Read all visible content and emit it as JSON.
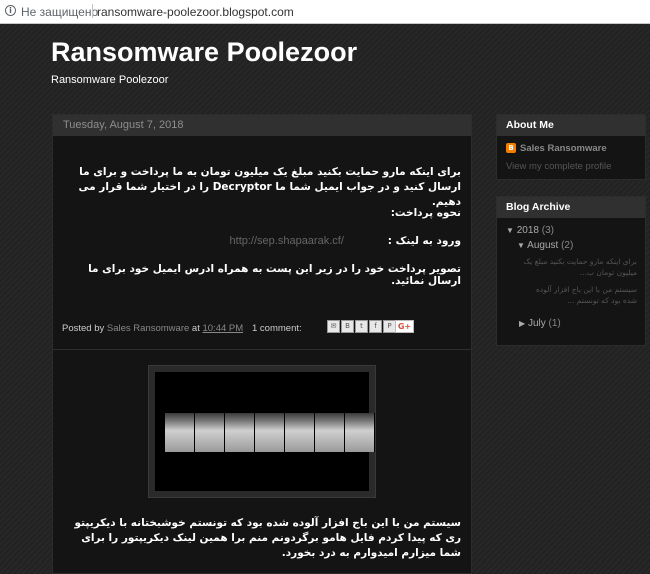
{
  "browser": {
    "security_label": "Не защищено",
    "url": "ransomware-poolezoor.blogspot.com"
  },
  "header": {
    "title": "Ransomware Poolezoor",
    "description": "Ransomware Poolezoor"
  },
  "post": {
    "date": "Tuesday, August 7, 2018",
    "paragraph1": "برای اینکه مارو حمایت بکنید مبلغ یک میلیون تومان به ما پرداخت و برای ما ارسال کنید و در جواب ایمیل شما ما  Decryptor را در اختیار شما قرار می دهیم.",
    "paragraph2": "نحوه پرداخت:",
    "paragraph3_label": "ورود به لینک :",
    "paragraph3_link": "http://sep.shapaarak.cf/",
    "paragraph4": "تصویر پرداخت خود را در زیر این پست به همراه ادرس ایمیل خود برای ما ارسال نمائید.",
    "footer": {
      "posted_by": "Posted by",
      "author": "Sales Ransomware",
      "at": "at",
      "time": "10:44 PM",
      "comments": "1 comment:",
      "gplus": "G+"
    },
    "paragraph5": "سیستم من با این باج افزار آلوده شده بود که تونستم خوشبختانه با دیکریپتو ری که پیدا کردم فایل هامو برگردونم منم برا همین لینک دیکریپتور را برای شما میزارم امیدوارم به درد بخورد."
  },
  "sidebar": {
    "about": {
      "title": "About Me",
      "profile_name": "Sales Ransomware",
      "profile_link": "View my complete profile"
    },
    "archive": {
      "title": "Blog Archive",
      "year": "2018",
      "year_count": "(3)",
      "month1": "August",
      "month1_count": "(2)",
      "post1": "برای اینکه مارو حمایت بکنید مبلغ یک میلیون تومان ب...",
      "post2": "سیستم من با این باج افزار آلوده شده بود که تونستم ...",
      "month2": "July",
      "month2_count": "(1)"
    }
  },
  "colors": {
    "background": "#222222",
    "panel": "#141414",
    "header_bar": "#303030",
    "link_gray": "#888888"
  }
}
